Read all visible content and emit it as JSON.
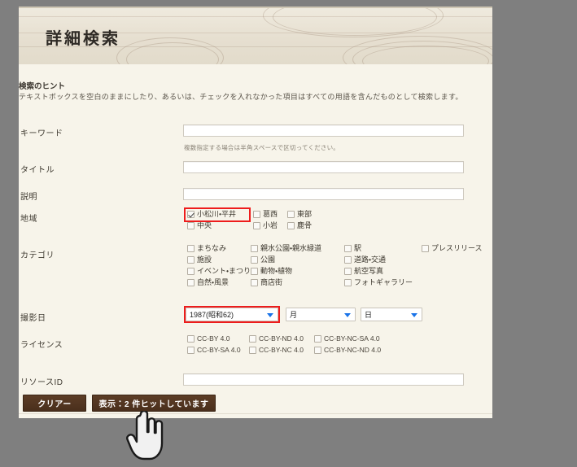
{
  "header": {
    "title": "詳細検索"
  },
  "hint": {
    "title": "検索のヒント",
    "body": "テキストボックスを空白のままにしたり、あるいは、チェックを入れなかった項目はすべての用語を含んだものとして検索します。"
  },
  "fields": {
    "keyword": {
      "label": "キーワード",
      "value": "",
      "placeholder": "",
      "subhint": "複数指定する場合は半角スペースで区切ってください。"
    },
    "title": {
      "label": "タイトル",
      "value": "",
      "placeholder": ""
    },
    "description": {
      "label": "説明",
      "value": "",
      "placeholder": ""
    },
    "region": {
      "label": "地域",
      "options": [
        {
          "label": "小松川・平井",
          "checked": true,
          "highlighted": true
        },
        {
          "label": "葛西",
          "checked": false
        },
        {
          "label": "東部",
          "checked": false
        },
        {
          "label": "中央",
          "checked": false
        },
        {
          "label": "小岩",
          "checked": false
        },
        {
          "label": "鹿骨",
          "checked": false
        }
      ]
    },
    "category": {
      "label": "カテゴリ",
      "columns": [
        [
          {
            "label": "まちなみ",
            "checked": false
          },
          {
            "label": "施設",
            "checked": false
          },
          {
            "label": "イベント・まつり",
            "checked": false
          },
          {
            "label": "自然・風景",
            "checked": false
          }
        ],
        [
          {
            "label": "親水公園・親水緑道",
            "checked": false
          },
          {
            "label": "公園",
            "checked": false
          },
          {
            "label": "動物・植物",
            "checked": false
          },
          {
            "label": "商店街",
            "checked": false
          }
        ],
        [
          {
            "label": "駅",
            "checked": false
          },
          {
            "label": "道路・交通",
            "checked": false
          },
          {
            "label": "航空写真",
            "checked": false
          },
          {
            "label": "フォトギャラリー",
            "checked": false
          }
        ],
        [
          {
            "label": "プレスリリース",
            "checked": false
          }
        ]
      ]
    },
    "shot_date": {
      "label": "撮影日",
      "year": {
        "value": "1987(昭和62)",
        "highlighted": true
      },
      "month": {
        "value": "月"
      },
      "day": {
        "value": "日"
      }
    },
    "license": {
      "label": "ライセンス",
      "rows": [
        [
          {
            "label": "CC-BY 4.0",
            "checked": false
          },
          {
            "label": "CC-BY-ND 4.0",
            "checked": false
          },
          {
            "label": "CC-BY-NC-SA 4.0",
            "checked": false
          }
        ],
        [
          {
            "label": "CC-BY-SA 4.0",
            "checked": false
          },
          {
            "label": "CC-BY-NC 4.0",
            "checked": false
          },
          {
            "label": "CC-BY-NC-ND 4.0",
            "checked": false
          }
        ]
      ]
    },
    "resource_id": {
      "label": "リソースID",
      "value": "",
      "placeholder": ""
    }
  },
  "buttons": {
    "clear": "クリアー",
    "submit": "表示：2 件ヒットしています"
  },
  "colors": {
    "accent_red": "#ee1c1c",
    "button_brown": "#4a2f1c",
    "page_bg": "#f7f4ea",
    "desktop_bg": "#7f7f7f"
  },
  "cursor": {
    "icon": "pointing-hand-cursor"
  }
}
